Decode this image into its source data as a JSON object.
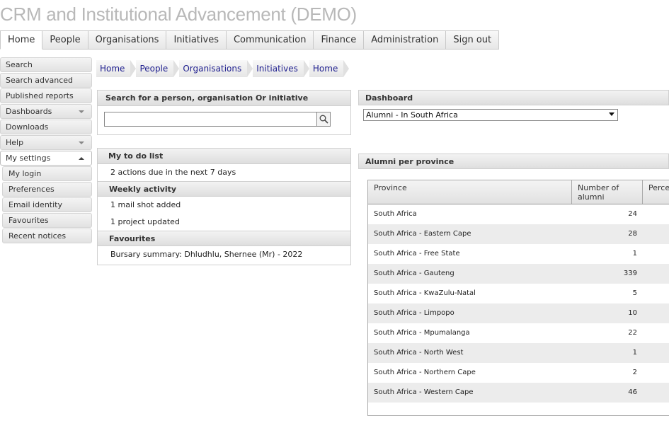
{
  "app_title": "CRM and Institutional Advancement (DEMO)",
  "top_nav": [
    {
      "label": "Home",
      "active": true
    },
    {
      "label": "People",
      "active": false
    },
    {
      "label": "Organisations",
      "active": false
    },
    {
      "label": "Initiatives",
      "active": false
    },
    {
      "label": "Communication",
      "active": false
    },
    {
      "label": "Finance",
      "active": false
    },
    {
      "label": "Administration",
      "active": false
    },
    {
      "label": "Sign out",
      "active": false
    }
  ],
  "sidebar": {
    "items": [
      {
        "label": "Search"
      },
      {
        "label": "Search advanced"
      },
      {
        "label": "Published reports"
      },
      {
        "label": "Dashboards"
      },
      {
        "label": "Downloads"
      },
      {
        "label": "Help"
      },
      {
        "label": "My settings"
      },
      {
        "label": "My login"
      },
      {
        "label": "Preferences"
      },
      {
        "label": "Email identity"
      },
      {
        "label": "Favourites"
      },
      {
        "label": "Recent notices"
      }
    ]
  },
  "breadcrumb": [
    "Home",
    "People",
    "Organisations",
    "Initiatives",
    "Home"
  ],
  "search_panel": {
    "title": "Search for a person, organisation Or initiative",
    "value": ""
  },
  "todo_panel": {
    "title": "My to do list",
    "todo_text": "2 actions due in the next 7 days",
    "weekly_title": "Weekly activity",
    "weekly_items": [
      "1 mail shot added",
      "1 project updated"
    ],
    "favourites_title": "Favourites",
    "favourites_items": [
      "Bursary summary: Dhludhlu, Shernee (Mr) - 2022"
    ]
  },
  "dashboard": {
    "title": "Dashboard",
    "selected": "Alumni - In South Africa"
  },
  "alumni": {
    "title": "Alumni per province",
    "columns": [
      "Province",
      "Number of alumni",
      "Perce"
    ],
    "rows": [
      {
        "province": "South Africa",
        "count": "24"
      },
      {
        "province": "South Africa - Eastern Cape",
        "count": "28"
      },
      {
        "province": "South Africa - Free State",
        "count": "1"
      },
      {
        "province": "South Africa - Gauteng",
        "count": "339"
      },
      {
        "province": "South Africa - KwaZulu-Natal",
        "count": "5"
      },
      {
        "province": "South Africa - Limpopo",
        "count": "10"
      },
      {
        "province": "South Africa - Mpumalanga",
        "count": "22"
      },
      {
        "province": "South Africa - North West",
        "count": "1"
      },
      {
        "province": "South Africa - Northern Cape",
        "count": "2"
      },
      {
        "province": "South Africa - Western Cape",
        "count": "46"
      }
    ]
  },
  "icons": {
    "search_button": "magnifier-icon"
  }
}
